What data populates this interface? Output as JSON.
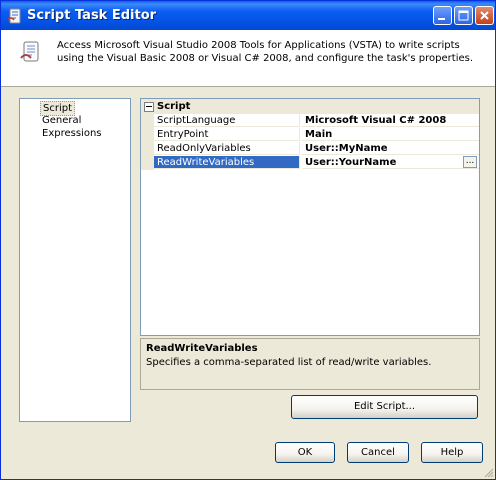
{
  "window": {
    "title": "Script Task Editor",
    "title_color": "#0a5ef3"
  },
  "header": {
    "description": "Access Microsoft Visual Studio 2008 Tools for Applications (VSTA) to write scripts using the Visual Basic 2008 or Visual C# 2008, and configure the task's properties."
  },
  "nav": {
    "items": [
      {
        "label": "Script",
        "selected": true
      },
      {
        "label": "General",
        "selected": false
      },
      {
        "label": "Expressions",
        "selected": false
      }
    ]
  },
  "property_grid": {
    "category": "Script",
    "rows": [
      {
        "name": "ScriptLanguage",
        "value": "Microsoft Visual C# 2008"
      },
      {
        "name": "EntryPoint",
        "value": "Main"
      },
      {
        "name": "ReadOnlyVariables",
        "value": "User::MyName"
      },
      {
        "name": "ReadWriteVariables",
        "value": "User::YourName"
      }
    ],
    "ellipsis_label": "...",
    "selection_color": "#316ac5"
  },
  "description_panel": {
    "title": "ReadWriteVariables",
    "text": "Specifies a comma-separated list of read/write variables."
  },
  "buttons": {
    "edit_script": "Edit Script...",
    "ok": "OK",
    "cancel": "Cancel",
    "help": "Help"
  }
}
